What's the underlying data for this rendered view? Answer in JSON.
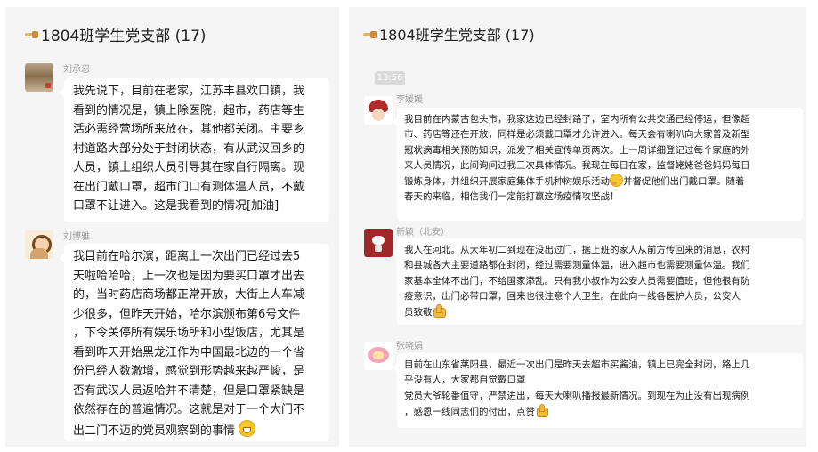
{
  "left_panel": {
    "title": "1804班学生党支部 (17)",
    "messages": [
      {
        "sender": "刘承忍",
        "lines": [
          "我先说下，目前在老家，江苏丰县欢口镇，我",
          "看到的情况是，镇上除医院，超市，药店等生",
          "活必需经营场所来放在，其他都关闭。主要乡",
          "村道路大部分处于封闭状态，有从武汉回乡的",
          "人员，镇上组织人员引导其在家自行隔离。现",
          "在出门戴口罩，超市门口有测体温人员，不戴",
          "口罩不让进入。这是我看到的情况[加油]"
        ]
      },
      {
        "sender": "刘博雅",
        "lines": [
          "我目前在哈尔滨，距离上一次出门已经过去5",
          "天啦哈哈哈，上一次也是因为要买口罩才出去",
          "的，当时药店商场都正常开放，大街上人车减",
          "少很多，但昨天开始，哈尔滨颁布第6号文件",
          "，下令关停所有娱乐场所和小型饭店，尤其是",
          "看到昨天开始黑龙江作为中国最北边的一个省",
          "份已经人数激增，感觉到形势越来越严峻，是",
          "否有武汉人员返哈并不清楚，但是口罩紧缺是",
          "依然存在的普遍情况。这就是对于一个大门不",
          "出二门不迈的党员观察到的事情"
        ],
        "trailing_emoji": "grin-emoji"
      }
    ]
  },
  "right_panel": {
    "title": "1804班学生党支部 (17)",
    "time_badge": "13:56",
    "messages": [
      {
        "sender": "李媛媛",
        "lines": [
          "我目前在内蒙古包头市，我家这边已经封路了，室内所有公共交通已经停运，但像超",
          "市、药店等还在开放，同样是必须戴口罩才允许进入。每天会有喇叭向大家普及新型",
          "冠状病毒相关预防知识，派发了相关宣传单页两次。上一周详细登记过每个家庭的外",
          "来人员情况，此间询问过我三次具体情况。我现在每日在家，监督姥姥爸爸妈妈每日",
          "锻炼身体，并组织开展家庭集体手机种树娱乐活动",
          "并督促他们出门戴口罩。随着",
          "春天的来临，相信我们一定能打赢这场疫情攻坚战！"
        ]
      },
      {
        "sender": "新颖（北安）",
        "lines": [
          "我人在河北。从大年初二到现在没出过门，据上班的家人从前方传回来的消息，农村",
          "和县城各大主要道路都在封闭，经过需要测量体温，进入超市也需要测量体温。我们",
          "家基本全体不出门，不给国家添乱。只有我小叔作为公安人员需要值班，但他很有防",
          "疫意识，出门必带口罩，回来也很注意个人卫生。在此向一线各医护人员，公安人",
          "员致敬"
        ]
      },
      {
        "sender": "张晓娟",
        "lines": [
          "目前在山东省莱阳县，最近一次出门是昨天去超市买酱油，镇上已完全封闭，路上几",
          "乎没有人，大家都自觉戴口罩",
          "党员大爷轮番值守，严禁进出，每天大喇叭播报最新情况。到现在为止没有出现病例",
          "，感恩一线同志们的付出，点赞"
        ]
      }
    ]
  },
  "icons": {
    "header_icon": "pointing-hand-icon",
    "emoji_grin": "grin-emoji",
    "emoji_think": "thinking-emoji",
    "emoji_thumb": "thumbs-up-emoji"
  },
  "colors": {
    "panel_bg": "#f5f5f5",
    "bubble_bg": "#ffffff",
    "sender_text": "#a0a0a0",
    "message_text": "#1b1b1b",
    "time_badge_bg": "#dadada"
  }
}
